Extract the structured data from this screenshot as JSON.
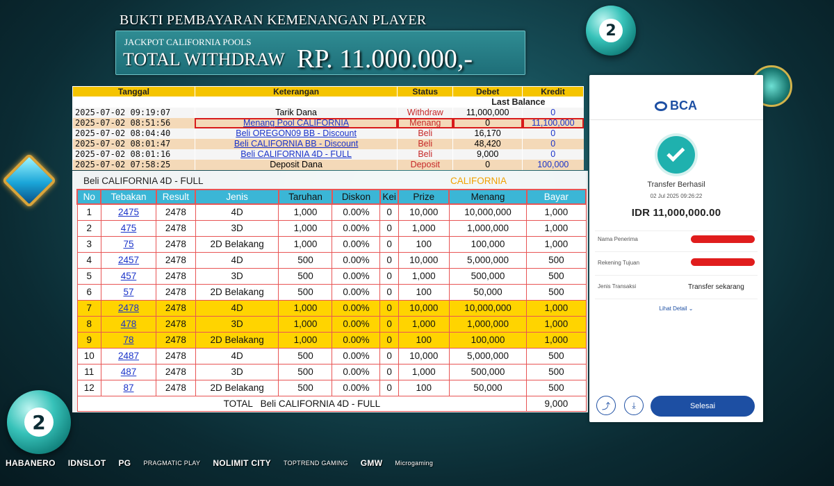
{
  "header": {
    "title": "BUKTI PEMBAYARAN KEMENANGAN PLAYER",
    "subtitle": "JACKPOT CALIFORNIA POOLS",
    "total_label": "TOTAL WITHDRAW",
    "total_amount": "RP. 11.000.000,-"
  },
  "balls": {
    "top_number": "2",
    "bottom_number": "2"
  },
  "statement": {
    "columns": [
      "Tanggal",
      "Keterangan",
      "Status",
      "Debet",
      "Kredit"
    ],
    "last_balance_label": "Last Balance",
    "rows": [
      {
        "date": "2025-07-02 09:19:07",
        "desc": "Tarik Dana",
        "status": "Withdraw",
        "debet": "11,000,000",
        "kredit": "0"
      },
      {
        "date": "2025-07-02 08:51:56",
        "desc": "Menang Pool CALIFORNIA",
        "status": "Menang",
        "debet": "0",
        "kredit": "11,100,000"
      },
      {
        "date": "2025-07-02 08:04:40",
        "desc": "Beli OREGON09 BB - Discount",
        "status": "Beli",
        "debet": "16,170",
        "kredit": "0"
      },
      {
        "date": "2025-07-02 08:01:47",
        "desc": "Beli CALIFORNIA BB - Discount",
        "status": "Beli",
        "debet": "48,420",
        "kredit": "0"
      },
      {
        "date": "2025-07-02 08:01:16",
        "desc": "Beli CALIFORNIA 4D - FULL",
        "status": "Beli",
        "debet": "9,000",
        "kredit": "0"
      },
      {
        "date": "2025-07-02 07:58:25",
        "desc": "Deposit Dana",
        "status": "Deposit",
        "debet": "0",
        "kredit": "100,000"
      }
    ]
  },
  "bet": {
    "title": "Beli CALIFORNIA 4D - FULL",
    "market": "CALIFORNIA",
    "columns": [
      "No",
      "Tebakan",
      "Result",
      "Jenis",
      "Taruhan",
      "Diskon",
      "Kei",
      "Prize",
      "Menang",
      "Bayar"
    ],
    "rows": [
      {
        "no": "1",
        "tebakan": "2475",
        "result": "2478",
        "jenis": "4D",
        "taruhan": "1,000",
        "diskon": "0.00%",
        "kei": "0",
        "prize": "10,000",
        "menang": "10,000,000",
        "bayar": "1,000"
      },
      {
        "no": "2",
        "tebakan": "475",
        "result": "2478",
        "jenis": "3D",
        "taruhan": "1,000",
        "diskon": "0.00%",
        "kei": "0",
        "prize": "1,000",
        "menang": "1,000,000",
        "bayar": "1,000"
      },
      {
        "no": "3",
        "tebakan": "75",
        "result": "2478",
        "jenis": "2D Belakang",
        "taruhan": "1,000",
        "diskon": "0.00%",
        "kei": "0",
        "prize": "100",
        "menang": "100,000",
        "bayar": "1,000"
      },
      {
        "no": "4",
        "tebakan": "2457",
        "result": "2478",
        "jenis": "4D",
        "taruhan": "500",
        "diskon": "0.00%",
        "kei": "0",
        "prize": "10,000",
        "menang": "5,000,000",
        "bayar": "500"
      },
      {
        "no": "5",
        "tebakan": "457",
        "result": "2478",
        "jenis": "3D",
        "taruhan": "500",
        "diskon": "0.00%",
        "kei": "0",
        "prize": "1,000",
        "menang": "500,000",
        "bayar": "500"
      },
      {
        "no": "6",
        "tebakan": "57",
        "result": "2478",
        "jenis": "2D Belakang",
        "taruhan": "500",
        "diskon": "0.00%",
        "kei": "0",
        "prize": "100",
        "menang": "50,000",
        "bayar": "500"
      },
      {
        "no": "7",
        "tebakan": "2478",
        "result": "2478",
        "jenis": "4D",
        "taruhan": "1,000",
        "diskon": "0.00%",
        "kei": "0",
        "prize": "10,000",
        "menang": "10,000,000",
        "bayar": "1,000"
      },
      {
        "no": "8",
        "tebakan": "478",
        "result": "2478",
        "jenis": "3D",
        "taruhan": "1,000",
        "diskon": "0.00%",
        "kei": "0",
        "prize": "1,000",
        "menang": "1,000,000",
        "bayar": "1,000"
      },
      {
        "no": "9",
        "tebakan": "78",
        "result": "2478",
        "jenis": "2D Belakang",
        "taruhan": "1,000",
        "diskon": "0.00%",
        "kei": "0",
        "prize": "100",
        "menang": "100,000",
        "bayar": "1,000"
      },
      {
        "no": "10",
        "tebakan": "2487",
        "result": "2478",
        "jenis": "4D",
        "taruhan": "500",
        "diskon": "0.00%",
        "kei": "0",
        "prize": "10,000",
        "menang": "5,000,000",
        "bayar": "500"
      },
      {
        "no": "11",
        "tebakan": "487",
        "result": "2478",
        "jenis": "3D",
        "taruhan": "500",
        "diskon": "0.00%",
        "kei": "0",
        "prize": "1,000",
        "menang": "500,000",
        "bayar": "500"
      },
      {
        "no": "12",
        "tebakan": "87",
        "result": "2478",
        "jenis": "2D Belakang",
        "taruhan": "500",
        "diskon": "0.00%",
        "kei": "0",
        "prize": "100",
        "menang": "50,000",
        "bayar": "500"
      }
    ],
    "total_label": "TOTAL   Beli CALIFORNIA 4D - FULL",
    "total_value": "9,000"
  },
  "bca": {
    "logo": "BCA",
    "success": "Transfer Berhasil",
    "date": "02 Jul 2025 09:26:22",
    "amount": "IDR 11,000,000.00",
    "fields": [
      {
        "label": "Nama Penerima",
        "value": ""
      },
      {
        "label": "Rekening Tujuan",
        "value": ""
      },
      {
        "label": "Jenis Transaksi",
        "value": "Transfer sekarang"
      }
    ],
    "detail_link": "Lihat Detail",
    "done_button": "Selesai"
  },
  "providers": [
    "HABANERO",
    "IDNSLOT",
    "PG",
    "PRAGMATIC PLAY",
    "NOLIMIT CITY",
    "TOPTREND GAMING",
    "GMW",
    "Microgaming"
  ]
}
